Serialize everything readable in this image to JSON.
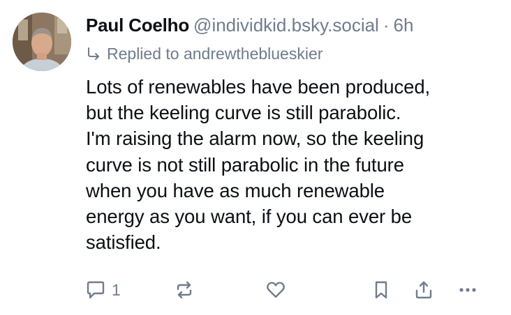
{
  "post": {
    "author": {
      "display_name": "Paul Coelho",
      "handle": "@individkid.bsky.social",
      "separator": "·",
      "timestamp": "6h"
    },
    "reply_context": {
      "text": "Replied to andrewtheblueskier"
    },
    "body": "Lots of renewables have been produced,\nbut the keeling curve is still parabolic.\nI'm raising the alarm now, so the keeling\ncurve is not still parabolic in the future\nwhen you have as much renewable\nenergy as you want, if you can ever be\nsatisfied.",
    "actions": {
      "reply_count": "1"
    },
    "icons": {
      "reply": "speech-bubble-icon",
      "repost": "repost-arrows-icon",
      "like": "heart-icon",
      "bookmark": "bookmark-icon",
      "share": "share-icon",
      "more": "ellipsis-icon",
      "reply_context": "reply-arrow-icon"
    },
    "colors": {
      "text_primary": "#0b0f14",
      "text_secondary": "#6f7c8c",
      "background": "#ffffff"
    }
  }
}
